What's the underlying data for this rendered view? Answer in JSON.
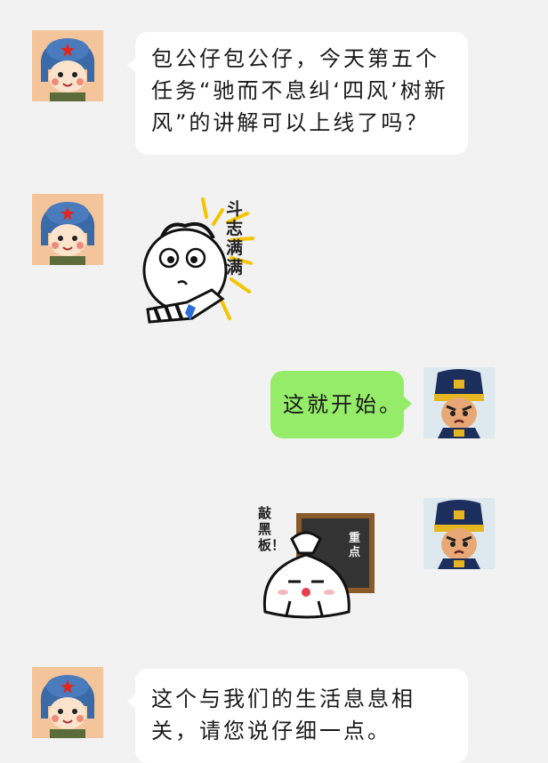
{
  "messages": [
    {
      "side": "left",
      "avatar": "soldier-avatar",
      "text": "包公仔包公仔，今天第五个任务“驰而不息纠‘四风’树新风”的讲解可以上线了吗？"
    },
    {
      "side": "left",
      "avatar": "soldier-avatar",
      "sticker": "fighting-spirit-sticker",
      "sticker_text": "斗志满满"
    },
    {
      "side": "right",
      "avatar": "bao-gong-avatar",
      "text": "这就开始。"
    },
    {
      "side": "right",
      "avatar": "bao-gong-avatar",
      "sticker": "blackboard-sticker",
      "sticker_text_1": "敲黑板！",
      "sticker_text_2": "重点"
    },
    {
      "side": "left",
      "avatar": "soldier-avatar",
      "text": "这个与我们的生活息息相关，请您说仔细一点。"
    }
  ],
  "colors": {
    "background": "#f2f2f2",
    "left_bubble": "#ffffff",
    "right_bubble": "#95ec69"
  }
}
